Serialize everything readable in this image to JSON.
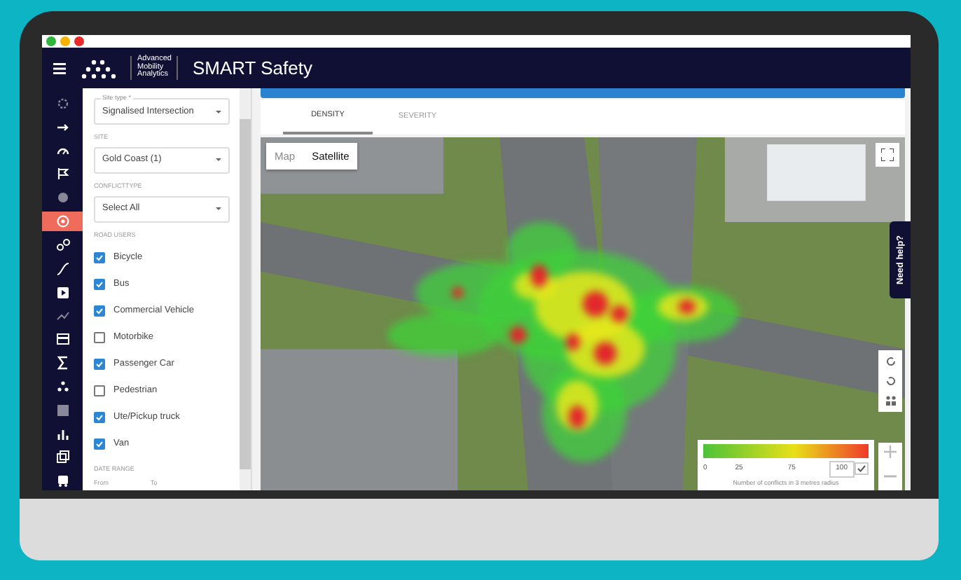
{
  "app": {
    "brand_lines": [
      "Advanced",
      "Mobility",
      "Analytics"
    ],
    "title": "SMART Safety"
  },
  "rail": [
    {
      "selected": false
    },
    {
      "selected": false
    },
    {
      "selected": false
    },
    {
      "selected": false
    },
    {
      "selected": false
    },
    {
      "selected": true
    },
    {
      "selected": false
    },
    {
      "selected": false
    },
    {
      "selected": false
    },
    {
      "selected": false
    },
    {
      "selected": false
    },
    {
      "selected": false
    },
    {
      "selected": false
    },
    {
      "selected": false
    },
    {
      "selected": false
    },
    {
      "selected": false
    },
    {
      "selected": false
    }
  ],
  "filters": {
    "fields": [
      {
        "label": "Site type *",
        "value": "Signalised Intersection",
        "floating": true
      },
      {
        "label": "SITE",
        "value": "Gold Coast (1)",
        "floating": false
      },
      {
        "label": "CONFLICTTYPE",
        "value": "Select All",
        "floating": false
      }
    ],
    "road_users_label": "ROAD USERS",
    "road_users": [
      {
        "label": "Bicycle",
        "checked": true
      },
      {
        "label": "Bus",
        "checked": true
      },
      {
        "label": "Commercial Vehicle",
        "checked": true
      },
      {
        "label": "Motorbike",
        "checked": false
      },
      {
        "label": "Passenger Car",
        "checked": true
      },
      {
        "label": "Pedestrian",
        "checked": false
      },
      {
        "label": "Ute/Pickup truck",
        "checked": true
      },
      {
        "label": "Van",
        "checked": true
      }
    ],
    "date_range": {
      "label": "DATE RANGE",
      "from": "From",
      "to": "To"
    }
  },
  "tabs": [
    {
      "label": "DENSITY",
      "selected": true
    },
    {
      "label": "SEVERITY",
      "selected": false
    }
  ],
  "map": {
    "types": [
      {
        "label": "Map",
        "selected": false
      },
      {
        "label": "Satellite",
        "selected": true
      }
    ],
    "legend": {
      "ticks": [
        "0",
        "25",
        "75"
      ],
      "max": "100",
      "caption": "Number of conflicts in 3 metres radius"
    }
  },
  "help": "Need help?"
}
